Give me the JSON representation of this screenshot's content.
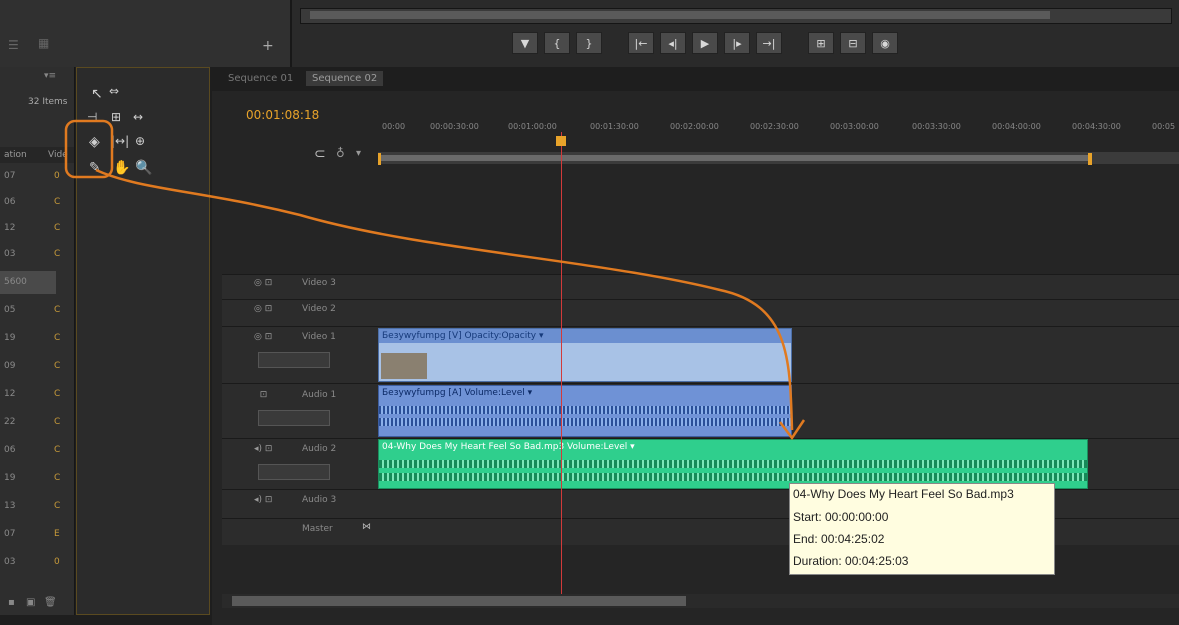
{
  "project": {
    "items_count": "32 Items",
    "column_left": "ation",
    "column_right": "Vide",
    "rows": [
      "07",
      "06",
      "12",
      "03",
      "5600",
      "05",
      "19",
      "09",
      "12",
      "22",
      "06",
      "19",
      "13",
      "07",
      "03"
    ]
  },
  "tabs": [
    "Sequence 01",
    "Sequence 02"
  ],
  "timeline": {
    "timecode": "00:01:08:18",
    "ticks": [
      "00:00",
      "00:00:30:00",
      "00:01:00:00",
      "00:01:30:00",
      "00:02:00:00",
      "00:02:30:00",
      "00:03:00:00",
      "00:03:30:00",
      "00:04:00:00",
      "00:04:30:00",
      "00:05"
    ]
  },
  "tracks": {
    "video3": "Video 3",
    "video2": "Video 2",
    "video1": "Video 1",
    "audio1": "Audio 1",
    "audio2": "Audio 2",
    "audio3": "Audio 3",
    "master": "Master"
  },
  "clips": {
    "video_clip": "Бeзуwуfumpg [V]  Opacity:Opacity ▾",
    "audio_clip_1": "Бeзуwуfumpg [A]  Volume:Level ▾",
    "audio_clip_2": "04-Why Does My Heart Feel So Bad.mp3  Volume:Level ▾"
  },
  "tooltip": {
    "title": "04-Why Does My Heart Feel So Bad.mp3",
    "start": "Start: 00:00:00:00",
    "end": "End: 00:04:25:02",
    "duration": "Duration: 00:04:25:03"
  },
  "colors": {
    "accent": "#e8a32a",
    "annotation": "#e07a20",
    "video_clip": "#9fb9e0",
    "audio_clip": "#7d9fd8",
    "music_clip": "#2ec98a",
    "playhead": "#d23a3a"
  }
}
